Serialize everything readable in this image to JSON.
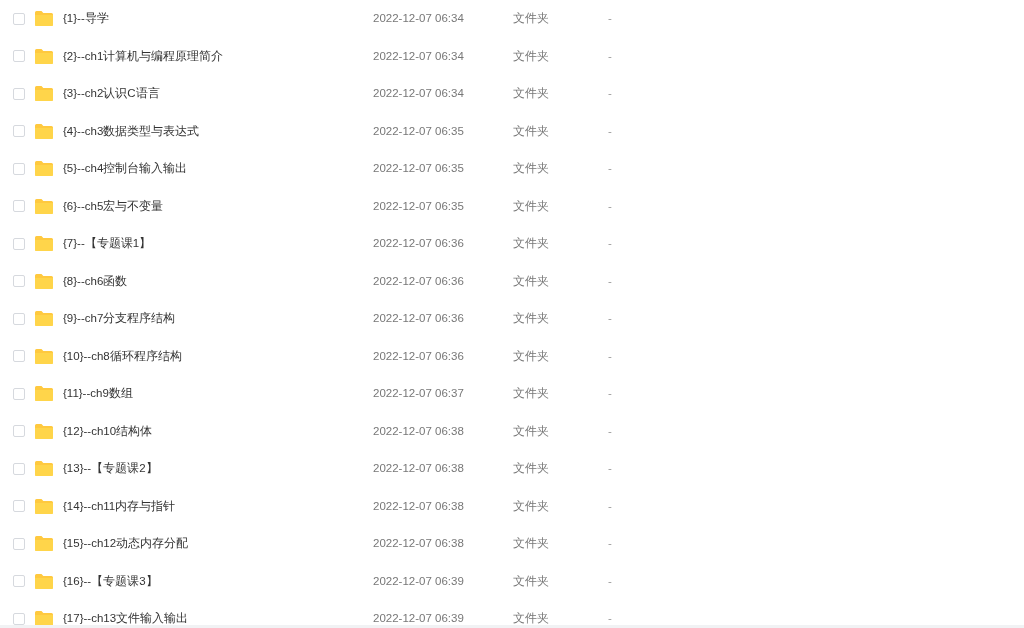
{
  "file_list": {
    "rows": [
      {
        "checked": false,
        "name": "{1}--导学",
        "date": "2022-12-07 06:34",
        "file_type": "文件夹",
        "column_5": "-"
      },
      {
        "checked": false,
        "name": "{2}--ch1计算机与编程原理简介",
        "date": "2022-12-07 06:34",
        "file_type": "文件夹",
        "column_5": "-"
      },
      {
        "checked": false,
        "name": "{3}--ch2认识C语言",
        "date": "2022-12-07 06:34",
        "file_type": "文件夹",
        "column_5": "-"
      },
      {
        "checked": false,
        "name": "{4}--ch3数据类型与表达式",
        "date": "2022-12-07 06:35",
        "file_type": "文件夹",
        "column_5": "-"
      },
      {
        "checked": false,
        "name": "{5}--ch4控制台输入输出",
        "date": "2022-12-07 06:35",
        "file_type": "文件夹",
        "column_5": "-"
      },
      {
        "checked": false,
        "name": "{6}--ch5宏与不变量",
        "date": "2022-12-07 06:35",
        "file_type": "文件夹",
        "column_5": "-"
      },
      {
        "checked": false,
        "name": "{7}--【专题课1】",
        "date": "2022-12-07 06:36",
        "file_type": "文件夹",
        "column_5": "-"
      },
      {
        "checked": false,
        "name": "{8}--ch6函数",
        "date": "2022-12-07 06:36",
        "file_type": "文件夹",
        "column_5": "-"
      },
      {
        "checked": false,
        "name": "{9}--ch7分支程序结构",
        "date": "2022-12-07 06:36",
        "file_type": "文件夹",
        "column_5": "-"
      },
      {
        "checked": false,
        "name": "{10}--ch8循环程序结构",
        "date": "2022-12-07 06:36",
        "file_type": "文件夹",
        "column_5": "-"
      },
      {
        "checked": false,
        "name": "{11}--ch9数组",
        "date": "2022-12-07 06:37",
        "file_type": "文件夹",
        "column_5": "-"
      },
      {
        "checked": false,
        "name": "{12}--ch10结构体",
        "date": "2022-12-07 06:38",
        "file_type": "文件夹",
        "column_5": "-"
      },
      {
        "checked": false,
        "name": "{13}--【专题课2】",
        "date": "2022-12-07 06:38",
        "file_type": "文件夹",
        "column_5": "-"
      },
      {
        "checked": false,
        "name": "{14}--ch11内存与指针",
        "date": "2022-12-07 06:38",
        "file_type": "文件夹",
        "column_5": "-"
      },
      {
        "checked": false,
        "name": "{15}--ch12动态内存分配",
        "date": "2022-12-07 06:38",
        "file_type": "文件夹",
        "column_5": "-"
      },
      {
        "checked": false,
        "name": "{16}--【专题课3】",
        "date": "2022-12-07 06:39",
        "file_type": "文件夹",
        "column_5": "-"
      },
      {
        "checked": false,
        "name": "{17}--ch13文件输入输出",
        "date": "2022-12-07 06:39",
        "file_type": "文件夹",
        "column_5": "-"
      }
    ]
  }
}
